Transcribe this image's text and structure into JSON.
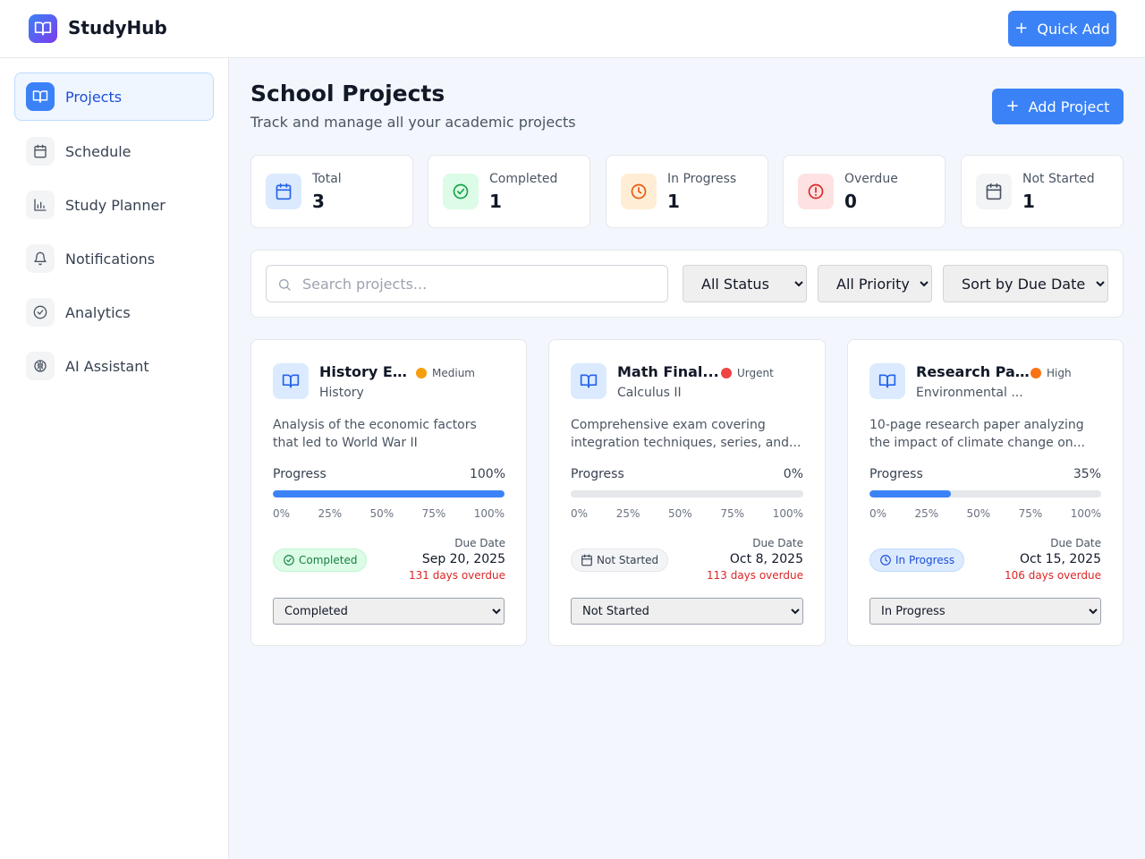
{
  "header": {
    "brand": "StudyHub",
    "quick_add_label": "Quick Add"
  },
  "sidebar": {
    "items": [
      {
        "label": "Projects",
        "icon": "book-open-icon"
      },
      {
        "label": "Schedule",
        "icon": "calendar-icon"
      },
      {
        "label": "Study Planner",
        "icon": "bar-chart-icon"
      },
      {
        "label": "Notifications",
        "icon": "bell-icon"
      },
      {
        "label": "Analytics",
        "icon": "check-circle-icon"
      },
      {
        "label": "AI Assistant",
        "icon": "brain-icon"
      }
    ],
    "active": "Projects"
  },
  "main": {
    "title": "School Projects",
    "subtitle": "Track and manage all your academic projects",
    "add_project_label": "Add Project"
  },
  "stats": [
    {
      "label": "Total",
      "value": "3",
      "icon": "calendar-icon",
      "color": "#2563eb",
      "bg": "#dbeafe"
    },
    {
      "label": "Completed",
      "value": "1",
      "icon": "check-circle-icon",
      "color": "#16a34a",
      "bg": "#dcfce7"
    },
    {
      "label": "In Progress",
      "value": "1",
      "icon": "clock-icon",
      "color": "#ea580c",
      "bg": "#ffedd5"
    },
    {
      "label": "Overdue",
      "value": "0",
      "icon": "alert-circle-icon",
      "color": "#dc2626",
      "bg": "#fee2e2"
    },
    {
      "label": "Not Started",
      "value": "1",
      "icon": "calendar-icon",
      "color": "#4b5563",
      "bg": "#f3f4f6"
    }
  ],
  "filters": {
    "search_placeholder": "Search projects...",
    "status": "All Status",
    "priority": "All Priority",
    "sort": "Sort by Due Date"
  },
  "progress_label": "Progress",
  "due_label": "Due Date",
  "ticks": [
    "0%",
    "25%",
    "50%",
    "75%",
    "100%"
  ],
  "projects": [
    {
      "title": "History E...",
      "priority": "Medium",
      "priority_color": "#f59e0b",
      "subject": "History",
      "description": "Analysis of the economic factors that led to World War II",
      "progress": 100,
      "progress_text": "100%",
      "status": "Completed",
      "status_icon": "check-circle-icon",
      "status_color": "#15803d",
      "status_bg": "#dcfce7",
      "status_border": "#bbf7d0",
      "due_date": "Sep 20, 2025",
      "overdue": "131 days overdue"
    },
    {
      "title": "Math Final...",
      "priority": "Urgent",
      "priority_color": "#ef4444",
      "subject": "Calculus II",
      "description": "Comprehensive exam covering integration techniques, series, and...",
      "progress": 0,
      "progress_text": "0%",
      "status": "Not Started",
      "status_icon": "calendar-icon",
      "status_color": "#374151",
      "status_bg": "#f3f4f6",
      "status_border": "#e5e7eb",
      "due_date": "Oct 8, 2025",
      "overdue": "113 days overdue"
    },
    {
      "title": "Research Pa...",
      "priority": "High",
      "priority_color": "#f97316",
      "subject": "Environmental ...",
      "description": "10-page research paper analyzing the impact of climate change on...",
      "progress": 35,
      "progress_text": "35%",
      "status": "In Progress",
      "status_icon": "clock-icon",
      "status_color": "#1d4ed8",
      "status_bg": "#dbeafe",
      "status_border": "#bfdbfe",
      "due_date": "Oct 15, 2025",
      "overdue": "106 days overdue"
    }
  ]
}
